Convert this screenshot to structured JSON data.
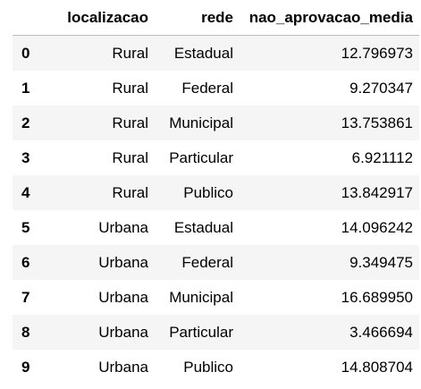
{
  "table": {
    "columns": [
      "",
      "localizacao",
      "rede",
      "nao_aprovacao_media"
    ],
    "rows": [
      {
        "index": "0",
        "localizacao": "Rural",
        "rede": "Estadual",
        "nao_aprovacao_media": "12.796973"
      },
      {
        "index": "1",
        "localizacao": "Rural",
        "rede": "Federal",
        "nao_aprovacao_media": "9.270347"
      },
      {
        "index": "2",
        "localizacao": "Rural",
        "rede": "Municipal",
        "nao_aprovacao_media": "13.753861"
      },
      {
        "index": "3",
        "localizacao": "Rural",
        "rede": "Particular",
        "nao_aprovacao_media": "6.921112"
      },
      {
        "index": "4",
        "localizacao": "Rural",
        "rede": "Publico",
        "nao_aprovacao_media": "13.842917"
      },
      {
        "index": "5",
        "localizacao": "Urbana",
        "rede": "Estadual",
        "nao_aprovacao_media": "14.096242"
      },
      {
        "index": "6",
        "localizacao": "Urbana",
        "rede": "Federal",
        "nao_aprovacao_media": "9.349475"
      },
      {
        "index": "7",
        "localizacao": "Urbana",
        "rede": "Municipal",
        "nao_aprovacao_media": "16.689950"
      },
      {
        "index": "8",
        "localizacao": "Urbana",
        "rede": "Particular",
        "nao_aprovacao_media": "3.466694"
      },
      {
        "index": "9",
        "localizacao": "Urbana",
        "rede": "Publico",
        "nao_aprovacao_media": "14.808704"
      }
    ]
  },
  "colors": {
    "stripe": "#f5f5f5",
    "header_border": "#bdbdbd"
  }
}
